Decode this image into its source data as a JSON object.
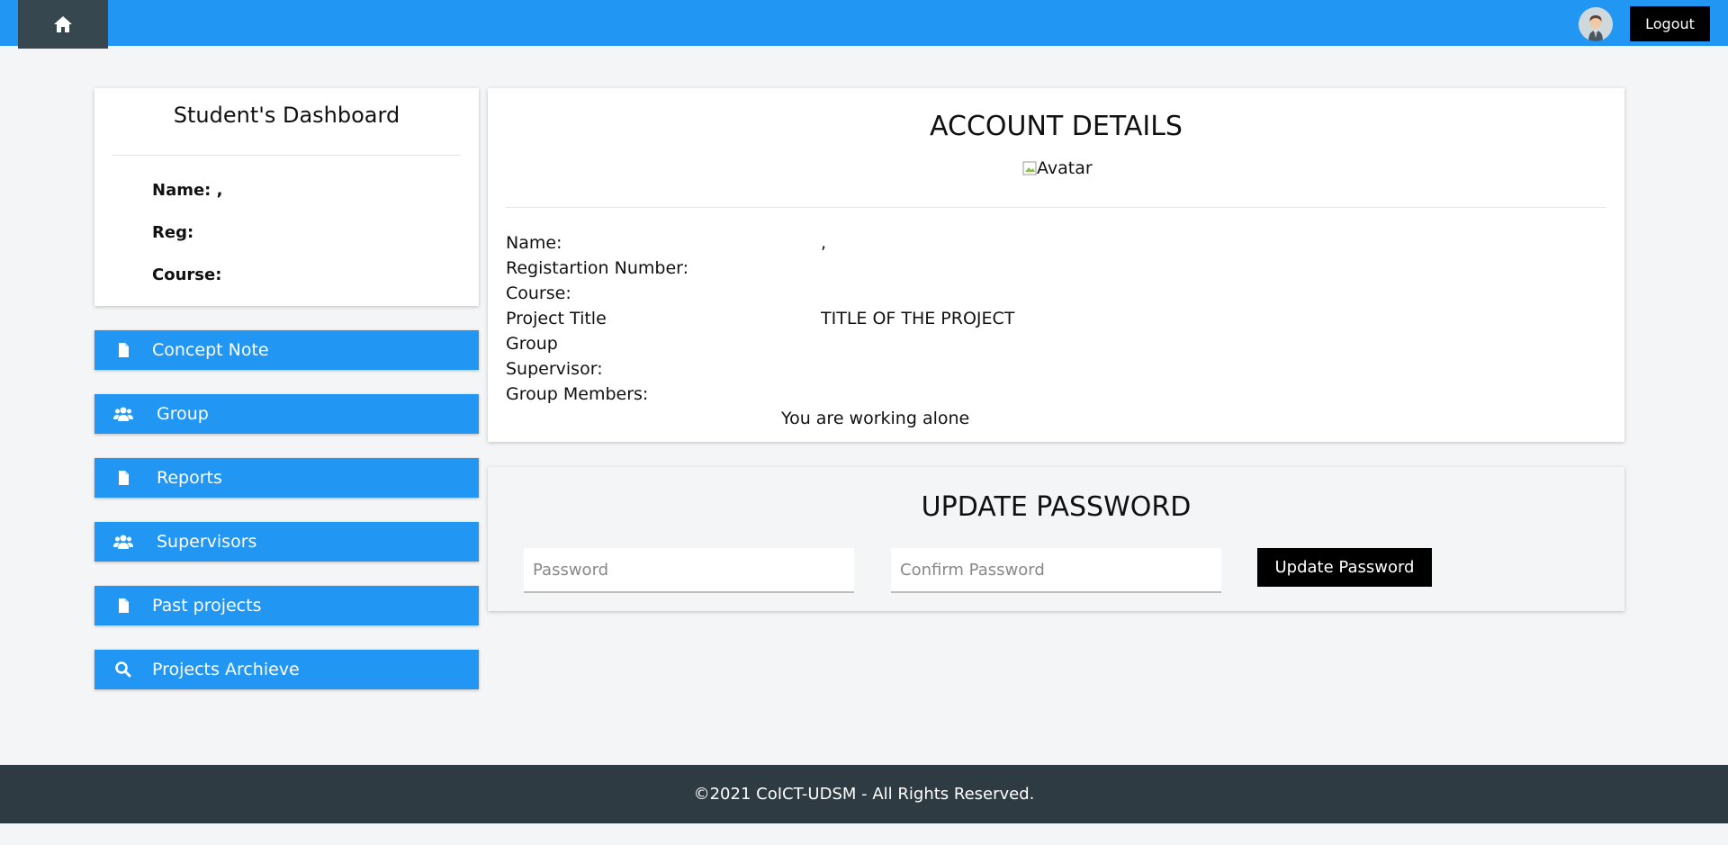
{
  "header": {
    "home_icon": "home-icon",
    "avatar_icon": "user-avatar",
    "logout_label": "Logout"
  },
  "dashboard": {
    "title": "Student's Dashboard",
    "rows": [
      {
        "label": "Name: ,"
      },
      {
        "label": "Reg:"
      },
      {
        "label": "Course:"
      }
    ]
  },
  "menu": [
    {
      "label": "Concept Note",
      "icon": "file-icon"
    },
    {
      "label": "Group",
      "icon": "users-icon"
    },
    {
      "label": "Reports",
      "icon": "file-icon"
    },
    {
      "label": "Supervisors",
      "icon": "users-icon"
    },
    {
      "label": "Past projects",
      "icon": "file-icon"
    },
    {
      "label": "Projects Archieve",
      "icon": "search-icon"
    }
  ],
  "account": {
    "title": "ACCOUNT DETAILS",
    "avatar_alt": "Avatar",
    "details": [
      {
        "label": "Name:",
        "value": ","
      },
      {
        "label": "Registartion Number:",
        "value": ""
      },
      {
        "label": "Course:",
        "value": ""
      },
      {
        "label": "Project Title",
        "value": "TITLE OF THE PROJECT"
      },
      {
        "label": "Group",
        "value": ""
      },
      {
        "label": "Supervisor:",
        "value": ""
      },
      {
        "label": "Group Members:",
        "value": ""
      }
    ],
    "working_alone": "You are working alone"
  },
  "password": {
    "title": "UPDATE PASSWORD",
    "password_placeholder": "Password",
    "password_value": "",
    "confirm_placeholder": "Confirm Password",
    "confirm_value": "",
    "button_label": "Update Password"
  },
  "footer": {
    "text": "©2021 CoICT-UDSM - All Rights Reserved."
  },
  "colors": {
    "primary": "#2196f3",
    "dark": "#37474f",
    "footer": "#2e3b43",
    "page_bg": "#f4f5f7"
  }
}
